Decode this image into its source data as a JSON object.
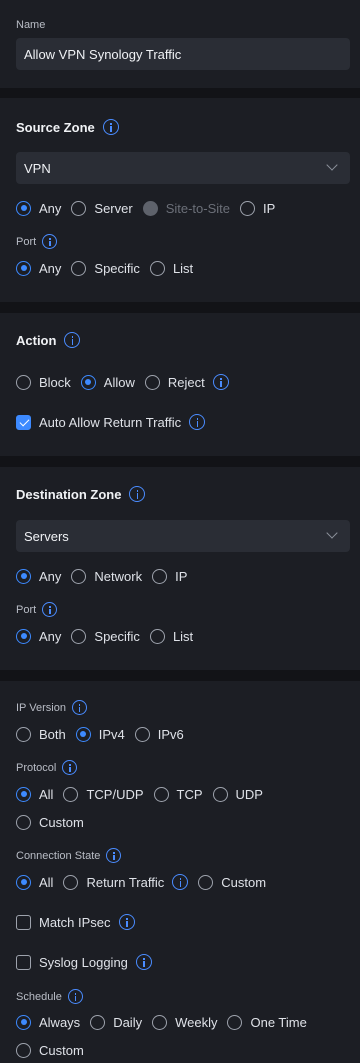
{
  "name": {
    "label": "Name",
    "value": "Allow VPN Synology Traffic"
  },
  "source_zone": {
    "title": "Source Zone",
    "selected": "VPN",
    "options": [
      "Any",
      "Server",
      "Site-to-Site",
      "IP"
    ],
    "selected_option": "Any",
    "disabled_option": "Site-to-Site",
    "port": {
      "label": "Port",
      "options": [
        "Any",
        "Specific",
        "List"
      ],
      "selected": "Any"
    }
  },
  "action": {
    "title": "Action",
    "options": [
      "Block",
      "Allow",
      "Reject"
    ],
    "selected": "Allow",
    "auto_allow_return": {
      "label": "Auto Allow Return Traffic",
      "checked": true
    }
  },
  "destination_zone": {
    "title": "Destination Zone",
    "selected": "Servers",
    "options": [
      "Any",
      "Network",
      "IP"
    ],
    "selected_option": "Any",
    "port": {
      "label": "Port",
      "options": [
        "Any",
        "Specific",
        "List"
      ],
      "selected": "Any"
    }
  },
  "advanced": {
    "ip_version": {
      "label": "IP Version",
      "options": [
        "Both",
        "IPv4",
        "IPv6"
      ],
      "selected": "IPv4"
    },
    "protocol": {
      "label": "Protocol",
      "options": [
        "All",
        "TCP/UDP",
        "TCP",
        "UDP",
        "Custom"
      ],
      "selected": "All"
    },
    "connection_state": {
      "label": "Connection State",
      "options": [
        "All",
        "Return Traffic",
        "Custom"
      ],
      "selected": "All"
    },
    "match_ipsec": {
      "label": "Match IPsec",
      "checked": false
    },
    "syslog_logging": {
      "label": "Syslog Logging",
      "checked": false
    },
    "schedule": {
      "label": "Schedule",
      "options": [
        "Always",
        "Daily",
        "Weekly",
        "One Time",
        "Custom"
      ],
      "selected": "Always"
    }
  },
  "colors": {
    "accent": "#3d8aff",
    "card": "#1c1e24",
    "background": "#121317",
    "input": "#2a2d35"
  }
}
